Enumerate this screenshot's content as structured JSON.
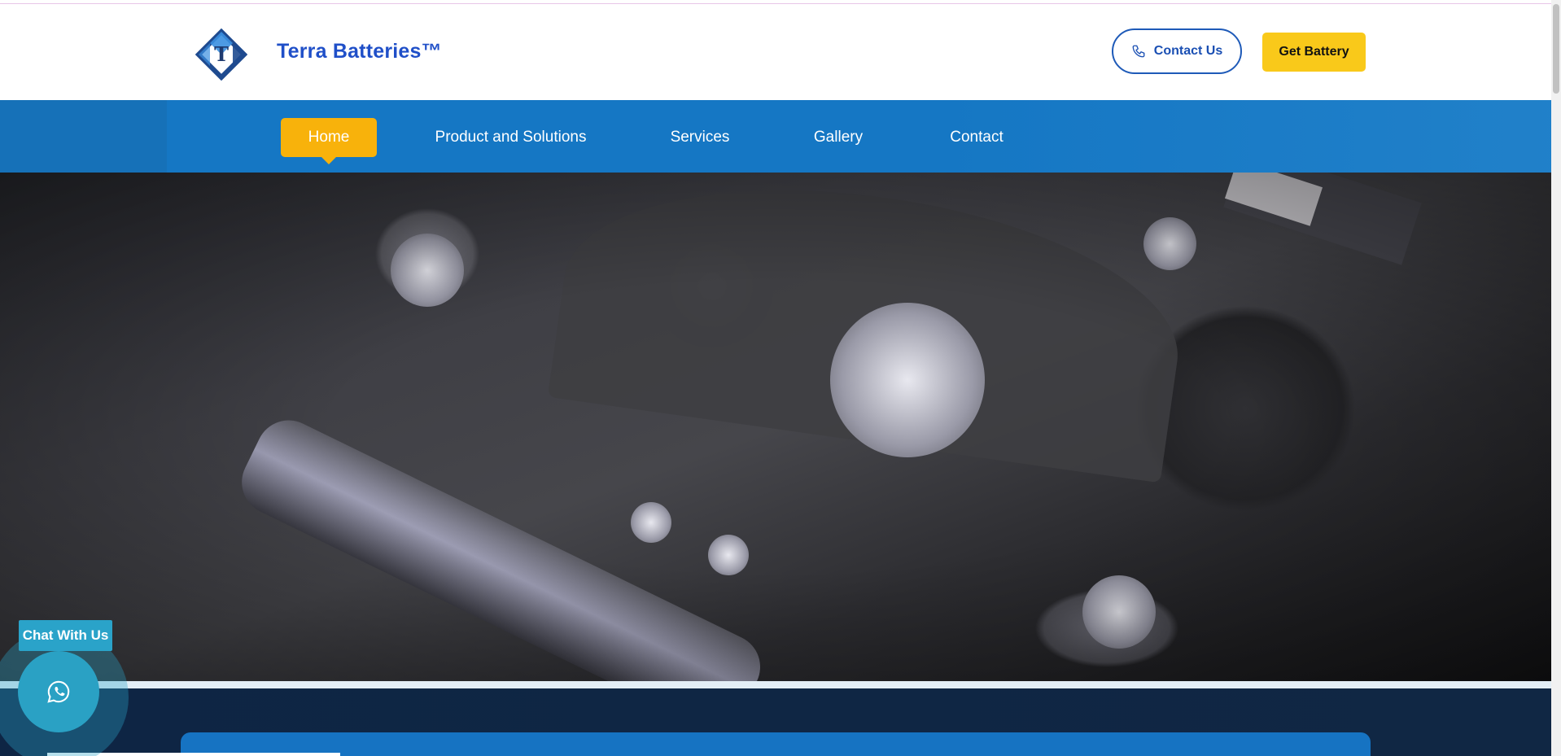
{
  "header": {
    "brand": "Terra Batteries™",
    "logo_letter": "T",
    "contact_button": "Contact Us",
    "get_battery_button": "Get Battery"
  },
  "nav": {
    "items": [
      {
        "label": "Home",
        "active": true
      },
      {
        "label": "Product and Solutions",
        "active": false
      },
      {
        "label": "Services",
        "active": false
      },
      {
        "label": "Gallery",
        "active": false
      },
      {
        "label": "Contact",
        "active": false
      }
    ]
  },
  "chat": {
    "label": "Chat With Us",
    "icon": "whatsapp-icon"
  },
  "colors": {
    "brand_blue": "#1f4fc8",
    "nav_blue": "#1577c4",
    "accent_yellow": "#f9c91a",
    "active_orange": "#f8b20b",
    "chat_teal": "#2aa1c4"
  }
}
